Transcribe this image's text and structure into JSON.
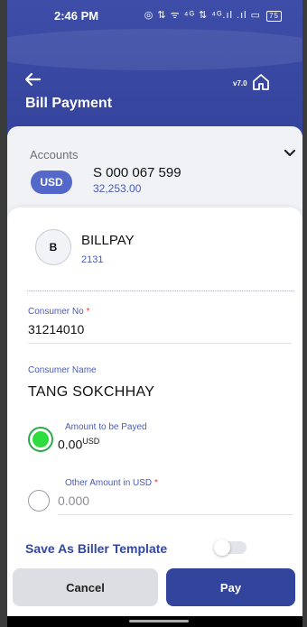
{
  "status_bar": {
    "time": "2:46 PM",
    "icons_text": "◎ ⇅ ᯤ ⁴ᴳ ⇅ ⁴ᴳ.ıl .ıl ▭",
    "battery_level": "75"
  },
  "header": {
    "title": "Bill Payment",
    "version": "v7.0",
    "back_icon": "left-arrow-icon",
    "home_icon": "home-icon"
  },
  "accounts": {
    "label": "Accounts",
    "currency": "USD",
    "account_number": "S 000 067 599",
    "balance": "32,253.00"
  },
  "biller": {
    "initial": "B",
    "name": "BILLPAY",
    "code": "2131"
  },
  "form": {
    "consumer_no_label": "Consumer No",
    "consumer_no_value": "31214010",
    "consumer_name_label": "Consumer Name",
    "consumer_name_value": "TANG SOKCHHAY",
    "amount_label": "Amount to be Payed",
    "amount_value": "0.00",
    "amount_currency": "USD",
    "other_amount_label": "Other Amount in USD",
    "other_amount_placeholder": "0.000",
    "required_mark": "*",
    "save_template_label": "Save As Biller Template"
  },
  "actions": {
    "cancel_label": "Cancel",
    "pay_label": "Pay"
  },
  "colors": {
    "primary": "#33449c",
    "accent_blue": "#4a5bb4",
    "selected_green": "#2fdc3e",
    "required_red": "#e53935"
  }
}
